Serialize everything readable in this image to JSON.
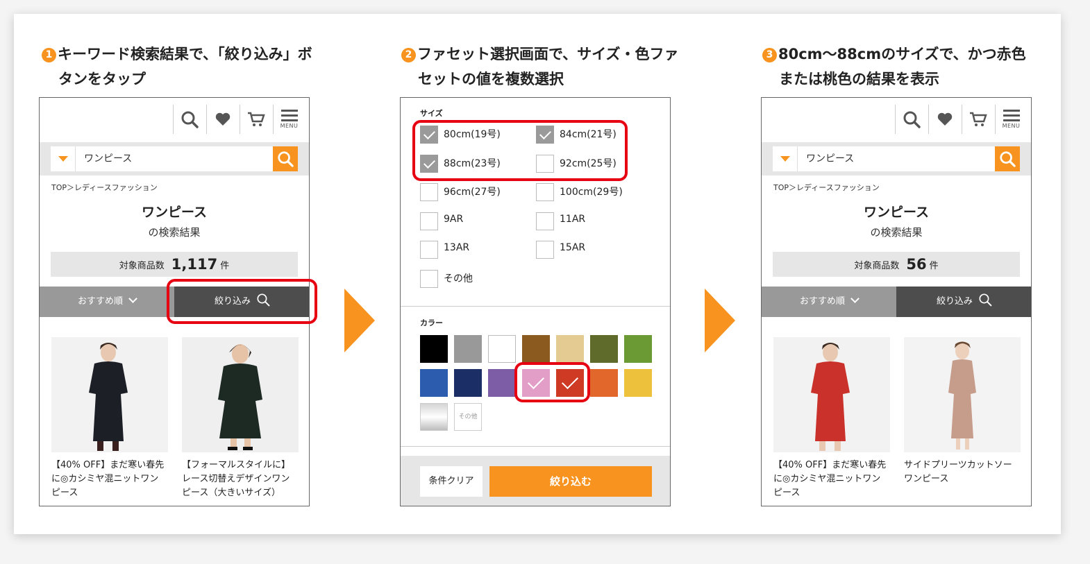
{
  "steps": [
    {
      "num": "1",
      "title_line1": "キーワード検索結果で、「絞り込み」ボ",
      "title_line2": "タンをタップ"
    },
    {
      "num": "2",
      "title_line1": "ファセット選択画面で、サイズ・色ファ",
      "title_line2": "セットの値を複数選択"
    },
    {
      "num": "3",
      "title_line1": "80cm〜88cmのサイズで、かつ赤色",
      "title_line2": "または桃色の結果を表示"
    }
  ],
  "header": {
    "menu_label": "MENU"
  },
  "search": {
    "value": "ワンピース"
  },
  "breadcrumb": "TOP＞レディースファッション",
  "results": {
    "title": "ワンピース",
    "subtitle": "の検索結果",
    "count_label": "対象商品数",
    "count_unit": "件"
  },
  "screen1": {
    "count": "1,117",
    "products": [
      {
        "line1": "【40% OFF】まだ寒い春先",
        "line2": "に◎カシミヤ混ニットワン",
        "line3": "ピース"
      },
      {
        "line1": "【フォーマルスタイルに】",
        "line2": "レース切替えデザインワン",
        "line3": "ピース（大きいサイズ）"
      }
    ]
  },
  "screen3": {
    "count": "56",
    "products": [
      {
        "line1": "【40% OFF】まだ寒い春先",
        "line2": "に◎カシミヤ混ニットワン",
        "line3": "ピース"
      },
      {
        "line1": "サイドプリーツカットソー",
        "line2": "ワンピース",
        "line3": ""
      }
    ]
  },
  "sort": {
    "label": "おすすめ順",
    "filter_label": "絞り込み"
  },
  "facets": {
    "size_label": "サイズ",
    "sizes": [
      {
        "label": "80cm(19号)",
        "checked": true
      },
      {
        "label": "84cm(21号)",
        "checked": true
      },
      {
        "label": "88cm(23号)",
        "checked": true
      },
      {
        "label": "92cm(25号)",
        "checked": false
      },
      {
        "label": "96cm(27号)",
        "checked": false
      },
      {
        "label": "100cm(29号)",
        "checked": false
      },
      {
        "label": "9AR",
        "checked": false
      },
      {
        "label": "11AR",
        "checked": false
      },
      {
        "label": "13AR",
        "checked": false
      },
      {
        "label": "15AR",
        "checked": false
      },
      {
        "label": "その他",
        "checked": false
      }
    ],
    "color_label": "カラー",
    "colors": [
      {
        "hex": "#000000",
        "selected": false
      },
      {
        "hex": "#999999",
        "selected": false
      },
      {
        "hex": "#ffffff",
        "selected": false
      },
      {
        "hex": "#8a5a1e",
        "selected": false
      },
      {
        "hex": "#e3cb91",
        "selected": false
      },
      {
        "hex": "#5f6b2b",
        "selected": false
      },
      {
        "hex": "#6b9a34",
        "selected": false
      },
      {
        "hex": "#2b5cad",
        "selected": false
      },
      {
        "hex": "#1b2f66",
        "selected": false
      },
      {
        "hex": "#7d5ea6",
        "selected": false
      },
      {
        "hex": "#e39ec8",
        "selected": true
      },
      {
        "hex": "#cf3a24",
        "selected": true
      },
      {
        "hex": "#e2672a",
        "selected": false
      },
      {
        "hex": "#eec13c",
        "selected": false
      }
    ],
    "other_color_label": "その他",
    "clear_label": "条件クリア",
    "apply_label": "絞り込む"
  },
  "accent_color": "#f7931e",
  "highlight_color": "#e60012"
}
